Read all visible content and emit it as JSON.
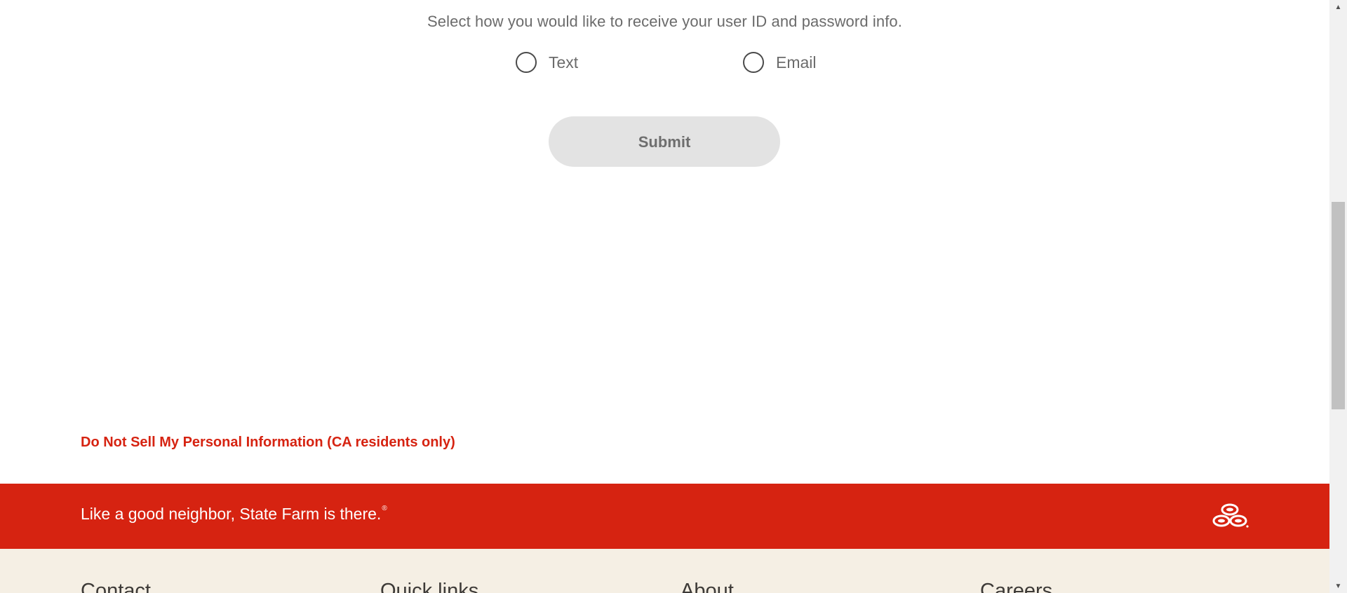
{
  "delivery": {
    "prompt": "Select how you would like to receive your user ID and password info.",
    "options": [
      {
        "label": "Text",
        "selected": false
      },
      {
        "label": "Email",
        "selected": false
      }
    ],
    "submit_label": "Submit"
  },
  "privacy": {
    "link_text": "Do Not Sell My Personal Information (CA residents only)"
  },
  "slogan_bar": {
    "slogan": "Like a good neighbor, State Farm is there.",
    "mark": "®",
    "logo_icon": "state-farm-three-ovals-logo"
  },
  "footer": {
    "headings": [
      "Contact",
      "Quick links",
      "About",
      "Careers"
    ]
  },
  "colors": {
    "brand_red": "#d62311",
    "footer_bg": "#f5efe4",
    "button_disabled_bg": "#e3e3e3"
  }
}
